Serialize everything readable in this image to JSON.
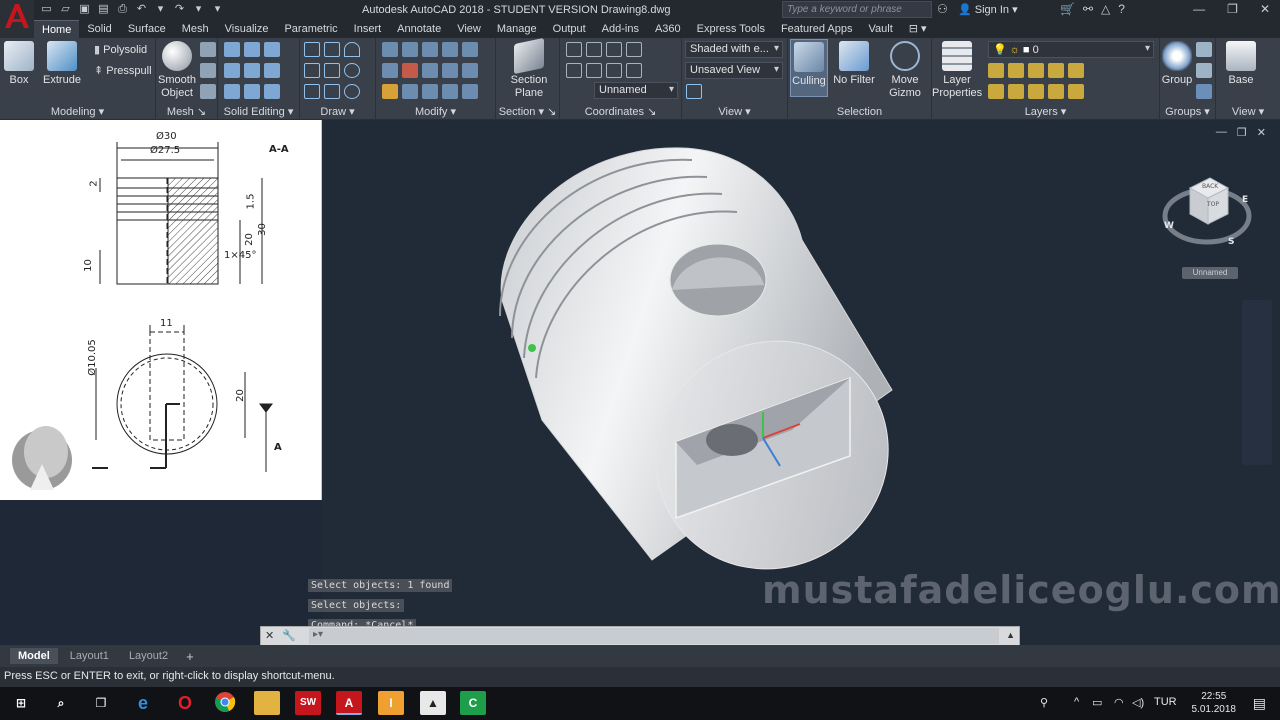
{
  "titlebar": {
    "title": "Autodesk AutoCAD 2018 - STUDENT VERSION    Drawing8.dwg",
    "search_placeholder": "Type a keyword or phrase",
    "signin": "Sign In"
  },
  "tabs": [
    "Home",
    "Solid",
    "Surface",
    "Mesh",
    "Visualize",
    "Parametric",
    "Insert",
    "Annotate",
    "View",
    "Manage",
    "Output",
    "Add-ins",
    "A360",
    "Express Tools",
    "Featured Apps",
    "Vault"
  ],
  "ribbon": {
    "modeling": {
      "title": "Modeling",
      "box": "Box",
      "extrude": "Extrude",
      "polysolid": "Polysolid",
      "presspull": "Presspull"
    },
    "mesh": {
      "title": "Mesh",
      "smooth_object": "Smooth Object"
    },
    "solid_editing": {
      "title": "Solid Editing"
    },
    "draw": {
      "title": "Draw"
    },
    "modify": {
      "title": "Modify"
    },
    "section": {
      "title": "Section",
      "section_plane": "Section Plane"
    },
    "coordinates": {
      "title": "Coordinates"
    },
    "view": {
      "title": "View",
      "visual_style": "Shaded with e...",
      "saved_view": "Unsaved View",
      "named": "Unnamed"
    },
    "selection": {
      "title": "Selection",
      "culling": "Culling",
      "no_filter": "No Filter",
      "move_gizmo": "Move Gizmo"
    },
    "layers": {
      "title": "Layers",
      "layer_properties": "Layer Properties",
      "current_layer": "0"
    },
    "groups": {
      "title": "Groups",
      "group": "Group"
    },
    "view2": {
      "title": "View",
      "base": "Base"
    }
  },
  "reference_drawing": {
    "d30": "Ø30",
    "d27_5": "Ø27.5",
    "section_label": "A-A",
    "dim_2": "2",
    "dim_1_5": "1.5",
    "dim_20": "20",
    "dim_30": "30",
    "dim_10": "10",
    "chamfer": "1×45°",
    "dim_11": "11",
    "d10_05": "Ø10.05",
    "dim_20b": "20",
    "arrow_label": "A"
  },
  "viewport": {
    "viewcube_badge": "Unnamed",
    "watermark": "mustafadeliceoglu.com"
  },
  "command_history": [
    "Select objects: 1 found",
    "Select objects:",
    "Command: *Cancel*"
  ],
  "layout_tabs": [
    "Model",
    "Layout1",
    "Layout2"
  ],
  "status": "Press ESC or ENTER to exit, or right-click to display shortcut-menu.",
  "taskbar": {
    "lang": "TUR",
    "time": "22:55",
    "date": "5.01.2018"
  },
  "colors": {
    "viewport_bg": "#212a37",
    "ribbon_bg": "#3a404a",
    "accent_red": "#c4161c"
  }
}
